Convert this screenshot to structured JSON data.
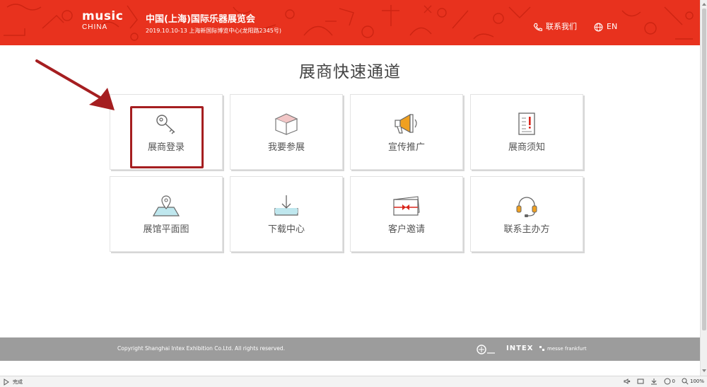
{
  "header": {
    "logo_main": "music",
    "logo_sub": "CHINA",
    "event_title": "中国(上海)国际乐器展览会",
    "event_sub": "2019.10.10-13 上海新国际博览中心(龙阳路2345号)",
    "contact_label": "联系我们",
    "lang_label": "EN",
    "brand_color": "#e8321e"
  },
  "main": {
    "title": "展商快速通道",
    "tiles": [
      {
        "label": "展商登录",
        "icon": "key-icon"
      },
      {
        "label": "我要参展",
        "icon": "box-icon"
      },
      {
        "label": "宣传推广",
        "icon": "megaphone-icon"
      },
      {
        "label": "展商须知",
        "icon": "notice-icon"
      },
      {
        "label": "展馆平面图",
        "icon": "map-icon"
      },
      {
        "label": "下载中心",
        "icon": "download-icon"
      },
      {
        "label": "客户邀请",
        "icon": "invitation-icon"
      },
      {
        "label": "联系主办方",
        "icon": "headset-icon"
      }
    ],
    "highlight_color": "#a51e20"
  },
  "footer": {
    "copyright": "Copyright Shanghai Intex Exhibition Co.Ltd. All rights reserved.",
    "sponsor_b": "INTEX",
    "sponsor_c": "messe frankfurt"
  },
  "statusbar": {
    "status_text": "完成",
    "count": "0",
    "zoom": "100%"
  }
}
